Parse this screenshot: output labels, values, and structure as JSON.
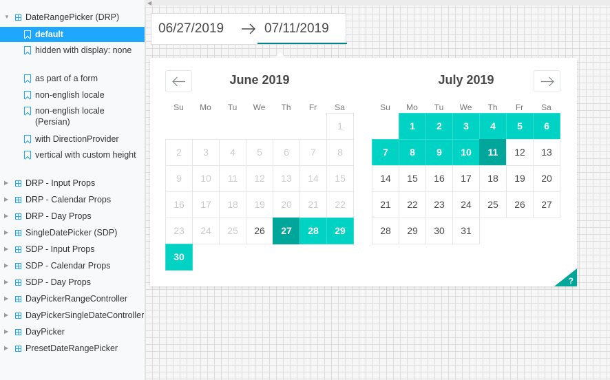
{
  "sidebar": {
    "top_group": {
      "label": "DateRangePicker (DRP)"
    },
    "stories": [
      {
        "label": "default",
        "active": true
      },
      {
        "label": "hidden with display: none"
      },
      {
        "label": "as part of a form"
      },
      {
        "label": "non-english locale"
      },
      {
        "label": "non-english locale (Persian)"
      },
      {
        "label": "with DirectionProvider"
      },
      {
        "label": "vertical with custom height"
      }
    ],
    "groups": [
      {
        "label": "DRP - Input Props"
      },
      {
        "label": "DRP - Calendar Props"
      },
      {
        "label": "DRP - Day Props"
      },
      {
        "label": "SingleDatePicker (SDP)"
      },
      {
        "label": "SDP - Input Props"
      },
      {
        "label": "SDP - Calendar Props"
      },
      {
        "label": "SDP - Day Props"
      },
      {
        "label": "DayPickerRangeController"
      },
      {
        "label": "DayPickerSingleDateController"
      },
      {
        "label": "DayPicker"
      },
      {
        "label": "PresetDateRangePicker"
      }
    ]
  },
  "drp": {
    "start_date": "06/27/2019",
    "end_date": "07/11/2019",
    "arrow_icon": "right-arrow-icon"
  },
  "calendar": {
    "weekdays": [
      "Su",
      "Mo",
      "Tu",
      "We",
      "Th",
      "Fr",
      "Sa"
    ],
    "prev_icon": "left-arrow-icon",
    "next_icon": "right-arrow-icon",
    "keyboard_shortcuts_label": "?",
    "months": [
      {
        "title": "June 2019",
        "first_weekday": 6,
        "days": 30,
        "blocked_through": 25,
        "selected": [
          27
        ],
        "in_range": [
          28,
          29,
          30
        ]
      },
      {
        "title": "July 2019",
        "first_weekday": 1,
        "days": 31,
        "blocked_through": 0,
        "selected": [
          11
        ],
        "in_range": [
          1,
          2,
          3,
          4,
          5,
          6,
          7,
          8,
          9,
          10
        ]
      }
    ]
  },
  "colors": {
    "accent": "#1ea7fd",
    "selected": "#00a699",
    "in_range": "#00d3c3"
  }
}
